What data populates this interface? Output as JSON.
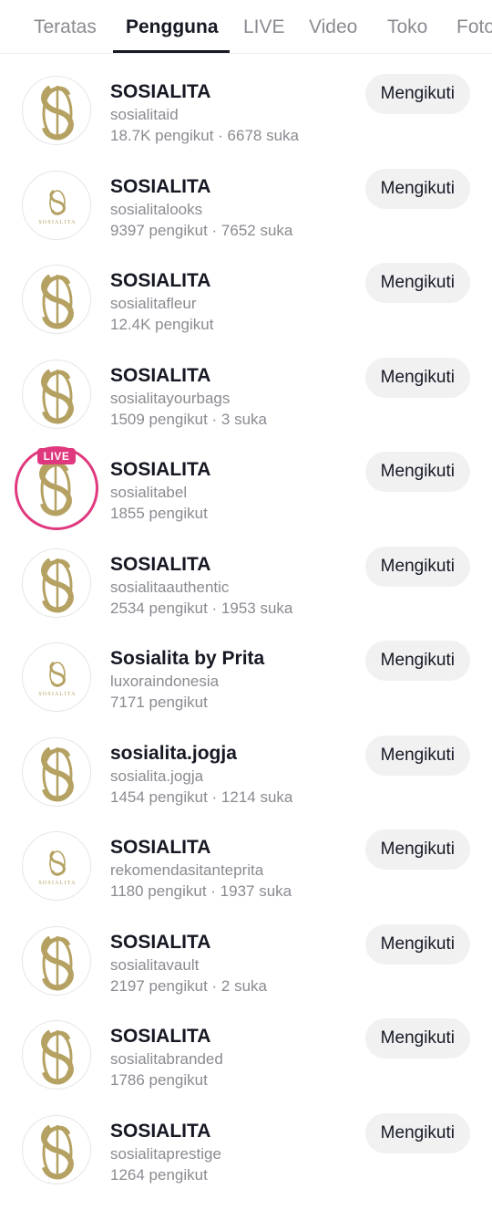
{
  "tabs": [
    {
      "label": "Teratas",
      "active": false
    },
    {
      "label": "Pengguna",
      "active": true
    },
    {
      "label": "LIVE",
      "active": false
    },
    {
      "label": "Video",
      "active": false
    },
    {
      "label": "Toko",
      "active": false
    },
    {
      "label": "Foto",
      "active": false
    }
  ],
  "colors": {
    "accent_live": "#e0387e",
    "logo_gold": "#b5a263",
    "text_primary": "#161823",
    "text_secondary": "#8a8b91",
    "button_bg": "#f1f1f2"
  },
  "follow_label": "Mengikuti",
  "live_label": "LIVE",
  "logo_caption": "SOSIALITA",
  "users": [
    {
      "name": "SOSIALITA",
      "handle": "sosialitaid",
      "stats": "18.7K pengikut · 6678 suka",
      "logo": "large",
      "live": false
    },
    {
      "name": "SOSIALITA",
      "handle": "sosialitalooks",
      "stats": "9397 pengikut · 7652 suka",
      "logo": "small",
      "live": false
    },
    {
      "name": "SOSIALITA",
      "handle": "sosialitafleur",
      "stats": "12.4K pengikut",
      "logo": "large",
      "live": false
    },
    {
      "name": "SOSIALITA",
      "handle": "sosialitayourbags",
      "stats": "1509 pengikut · 3 suka",
      "logo": "large",
      "live": false
    },
    {
      "name": "SOSIALITA",
      "handle": "sosialitabel",
      "stats": "1855 pengikut",
      "logo": "large",
      "live": true
    },
    {
      "name": "SOSIALITA",
      "handle": "sosialitaauthentic",
      "stats": "2534 pengikut · 1953 suka",
      "logo": "large",
      "live": false
    },
    {
      "name": "Sosialita by Prita",
      "handle": "luxoraindonesia",
      "stats": "7171 pengikut",
      "logo": "small",
      "live": false
    },
    {
      "name": "sosialita.jogja",
      "handle": "sosialita.jogja",
      "stats": "1454 pengikut · 1214 suka",
      "logo": "large",
      "live": false
    },
    {
      "name": "SOSIALITA",
      "handle": "rekomendasitanteprita",
      "stats": "1180 pengikut · 1937 suka",
      "logo": "small",
      "live": false
    },
    {
      "name": "SOSIALITA",
      "handle": "sosialitavault",
      "stats": "2197 pengikut · 2 suka",
      "logo": "large",
      "live": false
    },
    {
      "name": "SOSIALITA",
      "handle": "sosialitabranded",
      "stats": "1786 pengikut",
      "logo": "large",
      "live": false
    },
    {
      "name": "SOSIALITA",
      "handle": "sosialitaprestige",
      "stats": "1264 pengikut",
      "logo": "large",
      "live": false
    }
  ]
}
